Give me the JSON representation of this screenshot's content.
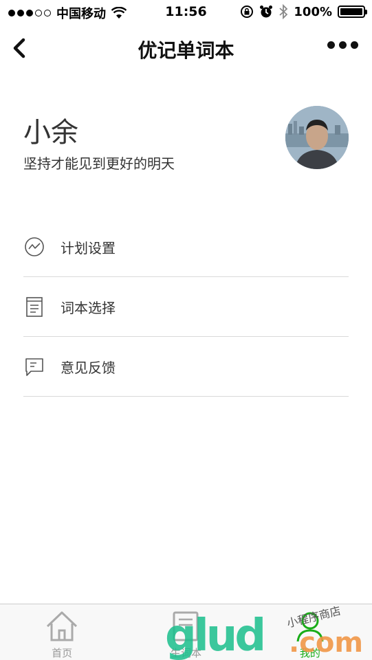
{
  "status_bar": {
    "carrier": "中国移动",
    "time": "11:56",
    "battery": "100%",
    "signal_icons": [
      "signal-dots-icon",
      "wifi-icon"
    ],
    "right_icons": [
      "rotation-lock-icon",
      "alarm-icon",
      "bluetooth-icon",
      "battery-icon"
    ]
  },
  "nav": {
    "title": "优记单词本",
    "back_icon": "chevron-left-icon",
    "more_icon": "more-dots-icon"
  },
  "profile": {
    "name": "小余",
    "motto": "坚持才能见到更好的明天"
  },
  "menu": {
    "items": [
      {
        "label": "计划设置",
        "icon": "plan-chart-icon"
      },
      {
        "label": "词本选择",
        "icon": "book-icon"
      },
      {
        "label": "意见反馈",
        "icon": "feedback-icon"
      }
    ]
  },
  "tabbar": {
    "tabs": [
      {
        "label": "首页",
        "icon": "home-icon",
        "active": false
      },
      {
        "label": "生词本",
        "icon": "wordbook-icon",
        "active": false
      },
      {
        "label": "我的",
        "icon": "user-icon",
        "active": true
      }
    ]
  },
  "watermark": {
    "main": "glud",
    "suffix": ".com",
    "sub": "小程序商店"
  },
  "colors": {
    "active": "#1aad19",
    "inactive": "#999999",
    "divider": "#d9d9d9"
  }
}
